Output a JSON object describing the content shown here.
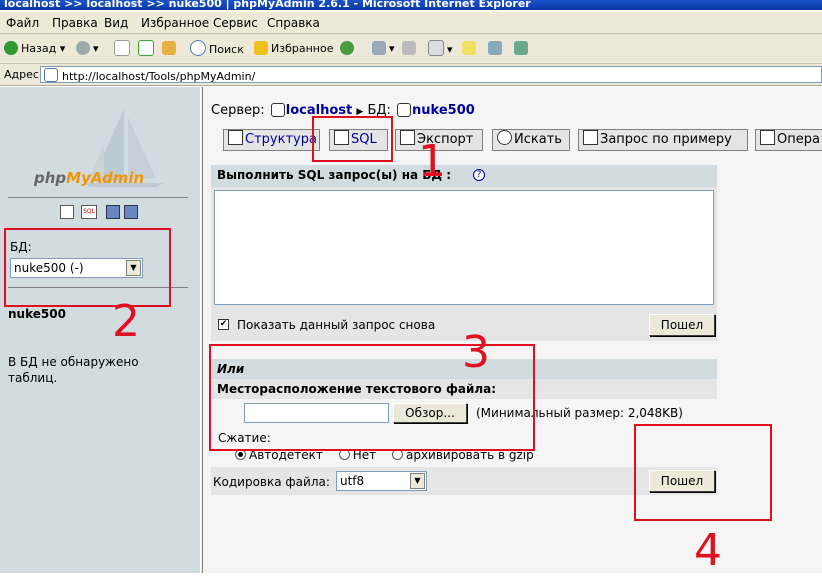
{
  "window": {
    "title": "localhost >> localhost >> nuke500 | phpMyAdmin 2.6.1 - Microsoft Internet Explorer"
  },
  "menu": [
    "Файл",
    "Правка",
    "Вид",
    "Избранное",
    "Сервис",
    "Справка"
  ],
  "toolbar": {
    "back": "Назад",
    "search": "Поиск",
    "favorites": "Избранное"
  },
  "address": {
    "label": "Адрес:",
    "url": "http://localhost/Tools/phpMyAdmin/"
  },
  "left": {
    "logo_php": "php",
    "logo_my": "MyAdmin",
    "db_label": "БД:",
    "db_selected": "nuke500 (-)",
    "db_name": "nuke500",
    "no_tables_1": "В БД не обнаружено",
    "no_tables_2": "таблиц."
  },
  "breadcrumb": {
    "server_label": "Сервер:",
    "server": "localhost",
    "db_label": "БД:",
    "db": "nuke500"
  },
  "tabs": [
    "Структура",
    "SQL",
    "Экспорт",
    "Искать",
    "Запрос по примеру",
    "Опера"
  ],
  "sql": {
    "header": "Выполнить SQL запрос(ы) на БД :",
    "show_query": "Показать данный запрос снова",
    "go": "Пошел"
  },
  "file": {
    "or": "Или",
    "location": "Месторасположение текстового файла:",
    "browse": "Обзор...",
    "maxsize": "(Минимальный размер: 2,048KB)",
    "compression": "Сжатие:",
    "options": [
      "Автодетект",
      "Нет",
      "архивировать в gzip"
    ],
    "encoding_label": "Кодировка файла:",
    "encoding": "utf8",
    "go": "Пошел"
  },
  "annotations": [
    "1",
    "2",
    "3",
    "4"
  ],
  "colors": {
    "accent_red": "#e01020",
    "title_blue": "#0a3aa8",
    "link_blue": "#0000a0",
    "left_bg": "#d0dce0"
  }
}
